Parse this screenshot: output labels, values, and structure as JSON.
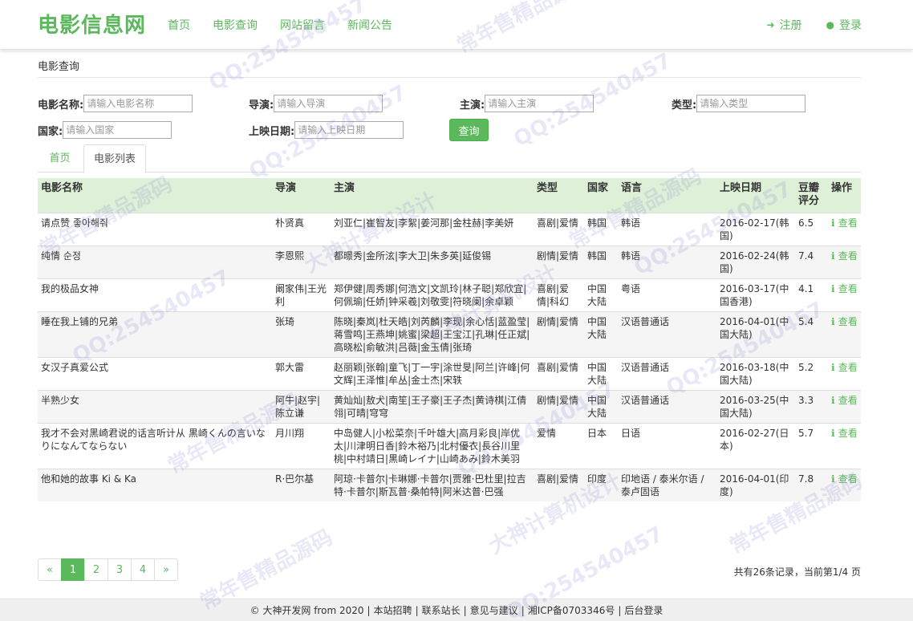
{
  "brand": "电影信息网",
  "nav": {
    "links": [
      "首页",
      "电影查询",
      "网站留言",
      "新闻公告"
    ],
    "register": "注册",
    "login": "登录"
  },
  "breadcrumb": "电影查询",
  "search": {
    "name_label": "电影名称:",
    "name_placeholder": "请输入电影名称",
    "director_label": "导演:",
    "director_placeholder": "请输入导演",
    "actor_label": "主演:",
    "actor_placeholder": "请输入主演",
    "type_label": "类型:",
    "type_placeholder": "请输入类型",
    "country_label": "国家:",
    "country_placeholder": "请输入国家",
    "date_label": "上映日期:",
    "date_placeholder": "请输入上映日期",
    "button": "查询"
  },
  "tabs": [
    "首页",
    "电影列表"
  ],
  "table": {
    "headers": [
      "电影名称",
      "导演",
      "主演",
      "类型",
      "国家",
      "语言",
      "上映日期",
      "豆瓣评分",
      "操作"
    ],
    "op_label": "查看",
    "rows": [
      {
        "name": "请点赞 좋아해줘",
        "director": "朴贤真",
        "actors": "刘亚仁|崔智友|李絮|姜河那|金柱赫|李美妍",
        "type": "喜剧|爱情",
        "country": "韩国",
        "lang": "韩语",
        "date": "2016-02-17(韩国)",
        "score": "6.5"
      },
      {
        "name": "纯情 순정",
        "director": "李恩熙",
        "actors": "都暻秀|金所泫|李大卫|朱多英|延俊锡",
        "type": "剧情|爱情",
        "country": "韩国",
        "lang": "韩语",
        "date": "2016-02-24(韩国)",
        "score": "7.4"
      },
      {
        "name": "我的极品女神",
        "director": "阚家伟|王光利",
        "actors": "郑伊健|周秀娜|何浩文|文凯玲|林子聪|郑欣宜|何佩瑜|任娇|钟采羲|刘敬雯|符晓阑|余卓颖",
        "type": "喜剧|爱情|科幻",
        "country": "中国大陆",
        "lang": "粤语",
        "date": "2016-03-17(中国香港)",
        "score": "4.1"
      },
      {
        "name": "睡在我上铺的兄弟",
        "director": "张琦",
        "actors": "陈晓|秦岚|杜天皓|刘芮麟|李现|余心恬|蓝盈莹|蒋雪鸣|王燕坤|姚蜜|梁超|王宝江|孔琳|任正斌|高晓松|俞敏洪|吕薇|金玉倩|张琦",
        "type": "剧情|爱情",
        "country": "中国大陆",
        "lang": "汉语普通话",
        "date": "2016-04-01(中国大陆)",
        "score": "5.4"
      },
      {
        "name": "女汉子真爱公式",
        "director": "郭大雷",
        "actors": "赵丽颖|张翰|童飞|丁一宇|涂世旻|阿兰|许峰|何文辉|王泽惟|牟丛|金士杰|宋轶",
        "type": "喜剧|爱情",
        "country": "中国大陆",
        "lang": "汉语普通话",
        "date": "2016-03-18(中国大陆)",
        "score": "5.2"
      },
      {
        "name": "半熟少女",
        "director": "阿牛|赵宇|陈立谦",
        "actors": "黄灿灿|敖犬|南笙|王子豪|王子杰|黄诗棋|江倩翎|可晴|穹穹",
        "type": "剧情|爱情",
        "country": "中国大陆",
        "lang": "汉语普通话",
        "date": "2016-03-25(中国大陆)",
        "score": "3.3"
      },
      {
        "name": "我才不会对黑崎君说的话言听计从 黒崎くんの言いなりになんてならない",
        "director": "月川翔",
        "actors": "中岛健人|小松菜奈|千叶雄大|高月彩良|岸优太|川津明日香|鈴木裕乃|北村優衣|長谷川里桃|中村靖日|黒崎レイナ|山崎あみ|鈴木美羽",
        "type": "爱情",
        "country": "日本",
        "lang": "日语",
        "date": "2016-02-27(日本)",
        "score": "5.7"
      },
      {
        "name": "他和她的故事 Ki & Ka",
        "director": "R·巴尔基",
        "actors": "阿琼·卡普尔|卡琳娜·卡普尔|贾雅·巴杜里|拉吉特·卡普尔|斯瓦普·桑帕特|阿米达普·巴强",
        "type": "喜剧|爱情",
        "country": "印度",
        "lang": "印地语 / 泰米尔语 / 泰卢固语",
        "date": "2016-04-01(印度)",
        "score": "7.8"
      }
    ]
  },
  "pager": {
    "prev": "«",
    "pages": [
      "1",
      "2",
      "3",
      "4"
    ],
    "next": "»",
    "active": "1",
    "info": "共有26条记录，当前第1/4 页"
  },
  "footer": {
    "copyright": "© 大神开发网 from 2020",
    "links": [
      "本站招聘",
      "联系站长",
      "意见与建议",
      "湘ICP备0703346号",
      "后台登录"
    ]
  },
  "watermarks": [
    "常年售精品源码",
    "QQ:254540457",
    "大神计算机设计"
  ],
  "colors": {
    "accent": "#5cb85c",
    "header_bg": "#dff0d8"
  }
}
